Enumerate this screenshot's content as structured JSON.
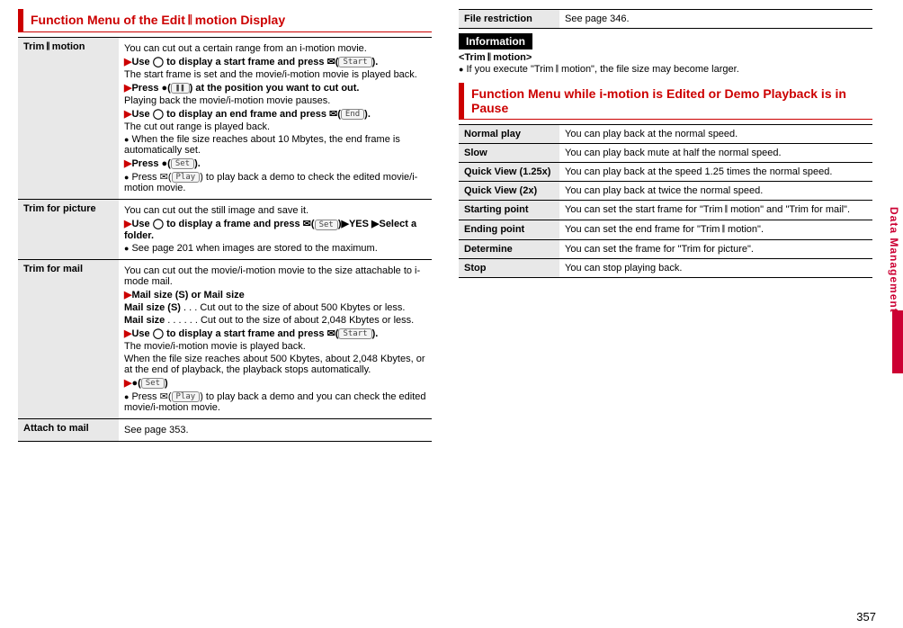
{
  "page_number": "357",
  "side_tab": "Data Management",
  "left": {
    "header": "Function Menu of the Edit 𝄃 motion Display",
    "table": [
      {
        "label": "Trim 𝄃 motion",
        "desc_blocks": [
          {
            "type": "plain",
            "text": "You can cut out a certain range from an i-motion movie."
          },
          {
            "type": "step",
            "bold": "Use ◯ to display a start frame and press ✉(",
            "keycap": "Start",
            "tail": ")."
          },
          {
            "type": "plain",
            "text": "The start frame is set and the movie/i-motion movie is played back."
          },
          {
            "type": "step",
            "bold": "Press ●(",
            "keycap": "❚❚",
            "tail": ") at the position you want to cut out."
          },
          {
            "type": "plain",
            "text": "Playing back the movie/i-motion movie pauses."
          },
          {
            "type": "step",
            "bold": "Use ◯ to display an end frame and press ✉(",
            "keycap": "End",
            "tail": ")."
          },
          {
            "type": "plain",
            "text": "The cut out range is played back."
          },
          {
            "type": "bullet",
            "text": "When the file size reaches about 10 Mbytes, the end frame is automatically set."
          },
          {
            "type": "step",
            "bold": "Press ●(",
            "keycap": "Set",
            "tail": ")."
          },
          {
            "type": "bullet_keycap",
            "pre": "Press ✉(",
            "keycap": "Play",
            "post": ") to play back a demo to check the edited movie/i-motion movie."
          }
        ]
      },
      {
        "label": "Trim for picture",
        "desc_blocks": [
          {
            "type": "plain",
            "text": "You can cut out the still image and save it."
          },
          {
            "type": "step",
            "bold": "Use ◯ to display a frame and press ✉(",
            "keycap": "Set",
            "tail": ")▶YES ▶Select a folder."
          },
          {
            "type": "bullet",
            "text": "See page 201 when images are stored to the maximum."
          }
        ]
      },
      {
        "label": "Trim for mail",
        "desc_blocks": [
          {
            "type": "plain",
            "text": "You can cut out the movie/i-motion movie to the size attachable to i-mode mail."
          },
          {
            "type": "step_plain",
            "bold": "Mail size (S) or Mail size"
          },
          {
            "type": "deflist",
            "term": "Mail size (S)",
            "dots": ". . .",
            "def": "Cut out to the size of about 500 Kbytes or less."
          },
          {
            "type": "deflist",
            "term": "Mail size",
            "dots": ". . . . . .",
            "def": "Cut out to the size of about 2,048 Kbytes or less."
          },
          {
            "type": "step",
            "bold": "Use ◯ to display a start frame and press ✉(",
            "keycap": "Start",
            "tail": ")."
          },
          {
            "type": "plain",
            "text": "The movie/i-motion movie is played back."
          },
          {
            "type": "plain",
            "text": "When the file size reaches about 500 Kbytes, about 2,048 Kbytes, or at the end of playback, the playback stops automatically."
          },
          {
            "type": "step",
            "bold": "●(",
            "keycap": "Set",
            "tail": ")"
          },
          {
            "type": "bullet_keycap",
            "pre": "Press ✉(",
            "keycap": "Play",
            "post": ") to play back a demo and you can check the edited movie/i-motion movie."
          }
        ]
      },
      {
        "label": "Attach to mail",
        "desc_blocks": [
          {
            "type": "plain",
            "text": "See page 353."
          }
        ]
      }
    ]
  },
  "right": {
    "top_table": [
      {
        "label": "File restriction",
        "desc": "See page 346."
      }
    ],
    "info_label": "Information",
    "info_title": "<Trim 𝄃 motion>",
    "info_text": "If you execute \"Trim 𝄃 motion\", the file size may become larger.",
    "header": "Function Menu while i-motion is Edited or Demo Playback is in Pause",
    "table": [
      {
        "label": "Normal play",
        "desc": "You can play back at the normal speed."
      },
      {
        "label": "Slow",
        "desc": "You can play back mute at half the normal speed."
      },
      {
        "label": "Quick View (1.25x)",
        "desc": "You can play back at the speed 1.25 times the normal speed."
      },
      {
        "label": "Quick View (2x)",
        "desc": "You can play back at twice the normal speed."
      },
      {
        "label": "Starting point",
        "desc": "You can set the start frame for \"Trim 𝄃 motion\" and \"Trim for mail\"."
      },
      {
        "label": "Ending point",
        "desc": "You can set the end frame for \"Trim 𝄃 motion\"."
      },
      {
        "label": "Determine",
        "desc": "You can set the frame for \"Trim for picture\"."
      },
      {
        "label": "Stop",
        "desc": "You can stop playing back."
      }
    ]
  }
}
